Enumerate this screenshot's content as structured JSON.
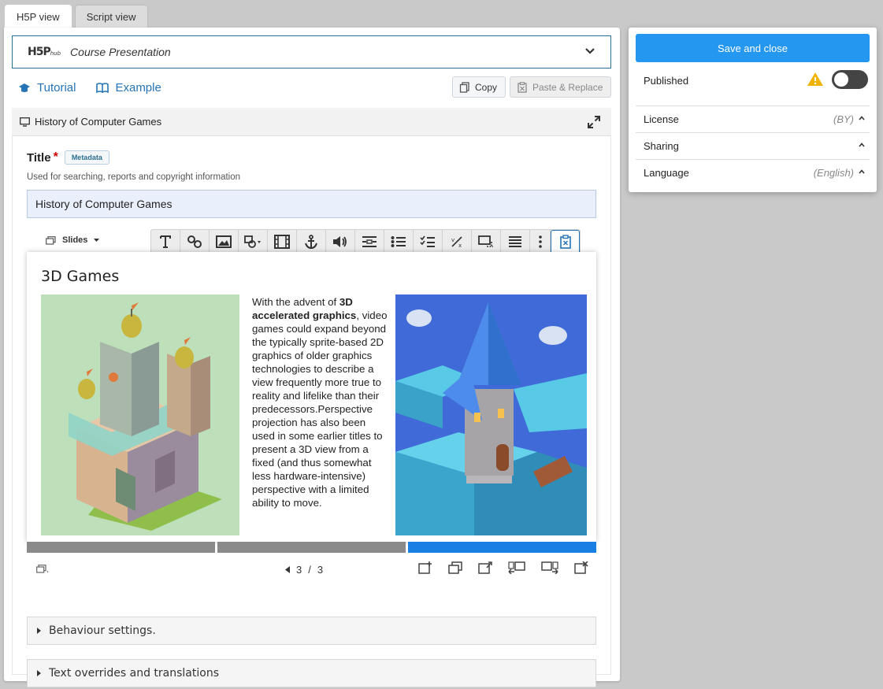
{
  "view_tabs": [
    "H5P view",
    "Script view"
  ],
  "hub": {
    "logo": "H5P",
    "logo_sub": "hub",
    "content_type": "Course Presentation"
  },
  "links": {
    "tutorial": "Tutorial",
    "example": "Example"
  },
  "actions": {
    "copy": "Copy",
    "paste_replace": "Paste & Replace"
  },
  "presentation": {
    "header_title": "History of Computer Games",
    "title_label": "Title",
    "required_mark": "*",
    "metadata_badge": "Metadata",
    "title_description": "Used for searching, reports and copyright information",
    "title_value": "History of Computer Games",
    "slides_menu": "Slides"
  },
  "slide": {
    "title": "3D Games",
    "text_pre": "With the advent of ",
    "text_bold": "3D accelerated graphics",
    "text_post": ", video games could expand beyond the typically sprite-based 2D graphics of older graphics technologies to describe a view frequently more true to reality and lifelike than their predecessors.Perspective projection has also been used in some earlier titles to present a 3D view from a fixed (and thus somewhat less hardware-intensive) perspective with a limited ability to move."
  },
  "navigation": {
    "current_page": "3",
    "separator": "/",
    "total_pages": "3",
    "current_slide_fraction": 1.0
  },
  "sections": {
    "behaviour": "Behaviour settings.",
    "text_overrides": "Text overrides and translations"
  },
  "panel": {
    "save_label": "Save and close",
    "published_label": "Published",
    "license_label": "License",
    "license_value": "(BY)",
    "sharing_label": "Sharing",
    "language_label": "Language",
    "language_value": "(English)"
  },
  "colors": {
    "accent": "#2497f0",
    "link": "#2674b5",
    "progress_active": "#1a7fe2",
    "warning": "#f0b400"
  }
}
